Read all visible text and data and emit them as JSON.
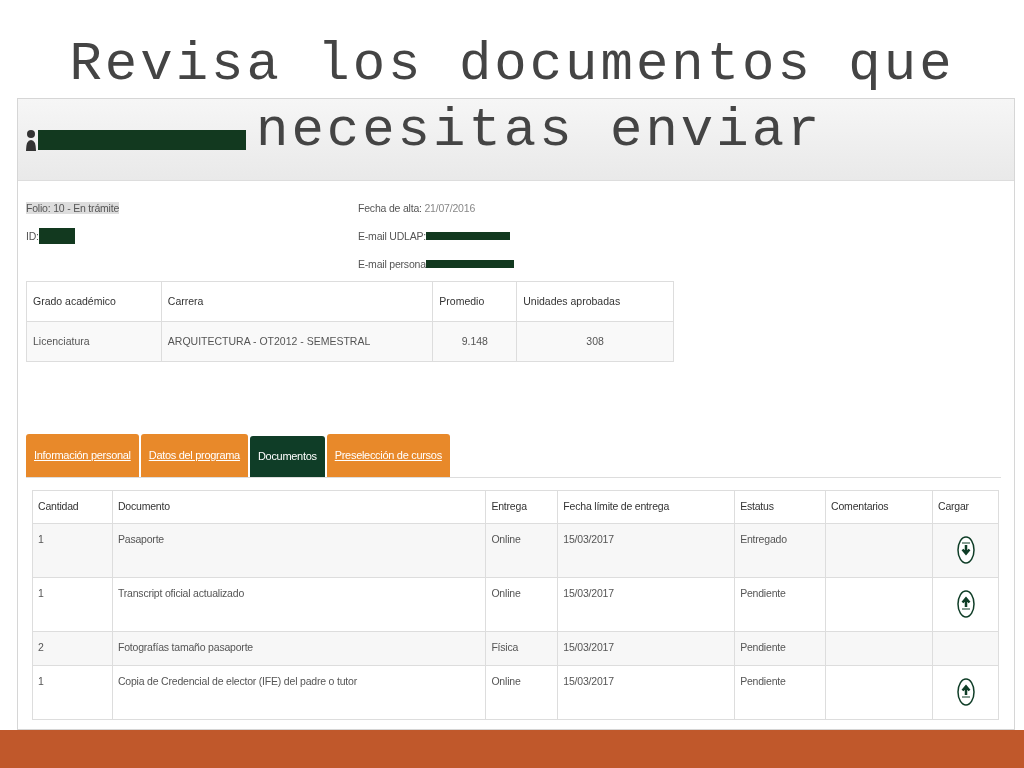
{
  "slide_title_lines": [
    "Revisa los documentos que",
    "necesitas enviar"
  ],
  "header": {
    "name_redacted": true
  },
  "info_left": [
    {
      "label": "Folio: 10 - En trámite",
      "highlighted": true,
      "redacted": false
    },
    {
      "label": "ID:",
      "highlighted": false,
      "redacted": true
    }
  ],
  "info_right": [
    {
      "label": "Fecha de alta:",
      "value": "21/07/2016",
      "redacted": false
    },
    {
      "label": "E-mail UDLAP:",
      "redacted": true
    },
    {
      "label": "E-mail persona",
      "redacted": true
    }
  ],
  "summary_table": {
    "columns": [
      "Grado académico",
      "Carrera",
      "Promedio",
      "Unidades aprobadas"
    ],
    "rows": [
      [
        "Licenciatura",
        "ARQUITECTURA - OT2012 - SEMESTRAL",
        "9.148",
        "308"
      ]
    ]
  },
  "tabs": [
    {
      "label": "Información personal",
      "selected": false
    },
    {
      "label": "Datos del programa",
      "selected": false
    },
    {
      "label": "Documentos",
      "selected": true
    },
    {
      "label": "Preselección de cursos",
      "selected": false
    }
  ],
  "documents_table": {
    "columns": [
      "Cantidad",
      "Documento",
      "Entrega",
      "Fecha límite de entrega",
      "Estatus",
      "Comentarios",
      "Cargar"
    ],
    "rows": [
      {
        "cells": [
          "1",
          "Pasaporte",
          "Online",
          "15/03/2017",
          "Entregado"
        ],
        "kind": "download"
      },
      {
        "cells": [
          "1",
          "Transcript oficial actualizado",
          "Online",
          "15/03/2017",
          "Pendiente"
        ],
        "kind": "upload"
      },
      {
        "cells": [
          "2",
          "Fotografías tamaño pasaporte",
          "Física",
          "15/03/2017",
          "Pendiente"
        ],
        "kind": "none"
      },
      {
        "cells": [
          "1",
          "Copia de Credencial de elector (IFE) del padre o tutor",
          "Online",
          "15/03/2017",
          "Pendiente"
        ],
        "kind": "upload"
      }
    ]
  }
}
